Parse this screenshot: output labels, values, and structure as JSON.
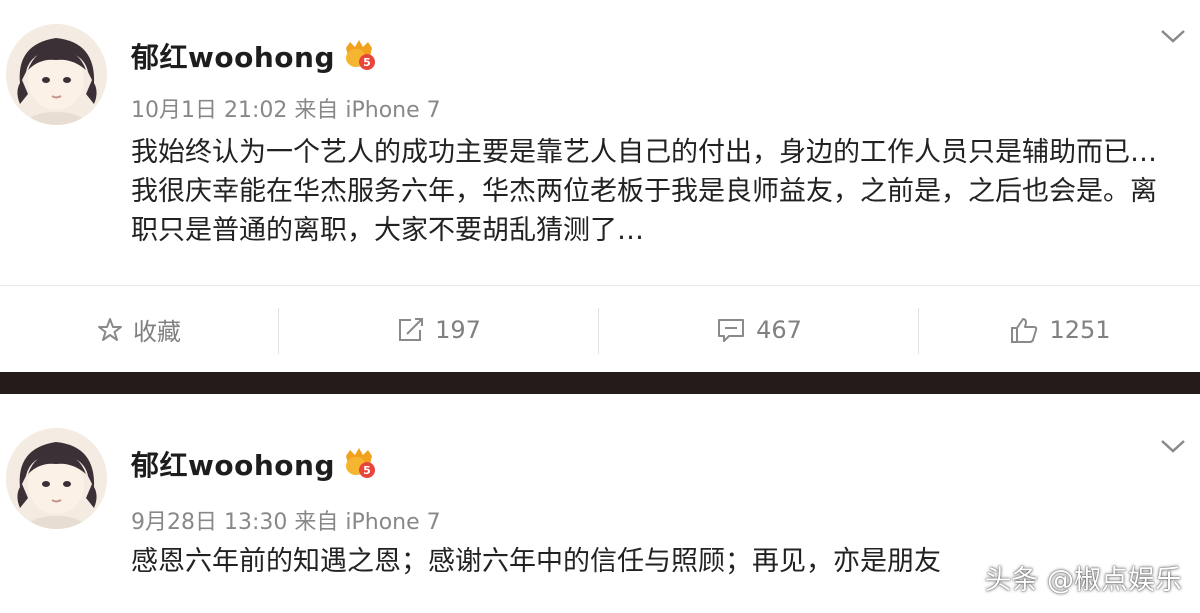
{
  "posts": [
    {
      "username": "郁红woohong",
      "meta": "10月1日 21:02 来自 iPhone 7",
      "content": "我始终认为一个艺人的成功主要是靠艺人自己的付出，身边的工作人员只是辅助而已…我很庆幸能在华杰服务六年，华杰两位老板于我是良师益友，之前是，之后也会是。离职只是普通的离职，大家不要胡乱猜测了…",
      "actions": {
        "favorite_label": "收藏",
        "repost_count": "197",
        "comment_count": "467",
        "like_count": "1251"
      }
    },
    {
      "username": "郁红woohong",
      "meta": "9月28日 13:30 来自 iPhone 7",
      "content": "感恩六年前的知遇之恩；感谢六年中的信任与照顾；再见，亦是朋友"
    }
  ],
  "watermark": "头条 @椒点娱乐",
  "colors": {
    "divider": "#241b1a",
    "vip_badge": "#f0a21e",
    "vip_level": "#e8463c"
  },
  "icons": [
    "avatar",
    "vip-badge-icon",
    "chevron-down-icon",
    "star-icon",
    "repost-icon",
    "comment-icon",
    "thumbs-up-icon"
  ]
}
